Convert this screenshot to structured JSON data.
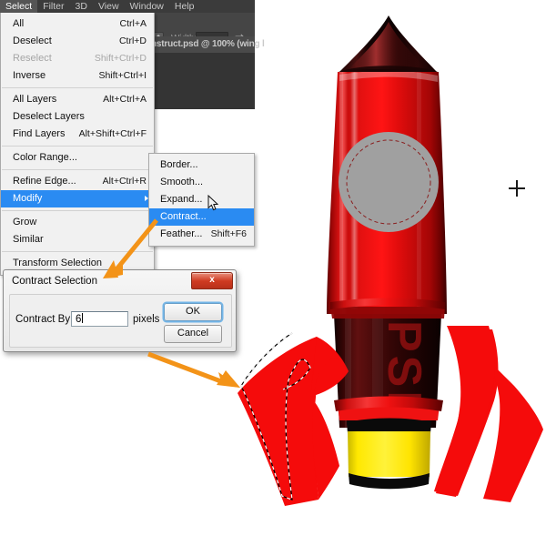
{
  "app": {
    "document_tab": "nstruct.psd @ 100% (wing l",
    "options_bar": {
      "width_label": "Width:",
      "width_value": "",
      "swap_icon": "swap-arrows-icon",
      "stepper_icon": "stepper-icon"
    }
  },
  "menubar": {
    "items": [
      {
        "label": "Select",
        "active": true
      },
      {
        "label": "Filter",
        "active": false
      },
      {
        "label": "3D",
        "active": false
      },
      {
        "label": "View",
        "active": false
      },
      {
        "label": "Window",
        "active": false
      },
      {
        "label": "Help",
        "active": false
      }
    ]
  },
  "select_menu": {
    "groups": [
      [
        {
          "label": "All",
          "accel": "Ctrl+A",
          "disabled": false,
          "highlight": false,
          "submenu": false
        },
        {
          "label": "Deselect",
          "accel": "Ctrl+D",
          "disabled": false,
          "highlight": false,
          "submenu": false
        },
        {
          "label": "Reselect",
          "accel": "Shift+Ctrl+D",
          "disabled": true,
          "highlight": false,
          "submenu": false
        },
        {
          "label": "Inverse",
          "accel": "Shift+Ctrl+I",
          "disabled": false,
          "highlight": false,
          "submenu": false
        }
      ],
      [
        {
          "label": "All Layers",
          "accel": "Alt+Ctrl+A",
          "disabled": false,
          "highlight": false,
          "submenu": false
        },
        {
          "label": "Deselect Layers",
          "accel": "",
          "disabled": false,
          "highlight": false,
          "submenu": false
        },
        {
          "label": "Find Layers",
          "accel": "Alt+Shift+Ctrl+F",
          "disabled": false,
          "highlight": false,
          "submenu": false
        }
      ],
      [
        {
          "label": "Color Range...",
          "accel": "",
          "disabled": false,
          "highlight": false,
          "submenu": false
        }
      ],
      [
        {
          "label": "Refine Edge...",
          "accel": "Alt+Ctrl+R",
          "disabled": false,
          "highlight": false,
          "submenu": false
        },
        {
          "label": "Modify",
          "accel": "",
          "disabled": false,
          "highlight": true,
          "submenu": true
        }
      ],
      [
        {
          "label": "Grow",
          "accel": "",
          "disabled": false,
          "highlight": false,
          "submenu": false
        },
        {
          "label": "Similar",
          "accel": "",
          "disabled": false,
          "highlight": false,
          "submenu": false
        }
      ],
      [
        {
          "label": "Transform Selection",
          "accel": "",
          "disabled": false,
          "highlight": false,
          "submenu": false
        }
      ]
    ]
  },
  "modify_submenu": {
    "items": [
      {
        "label": "Border...",
        "accel": "",
        "highlight": false
      },
      {
        "label": "Smooth...",
        "accel": "",
        "highlight": false
      },
      {
        "label": "Expand...",
        "accel": "",
        "highlight": false
      },
      {
        "label": "Contract...",
        "accel": "",
        "highlight": true
      },
      {
        "label": "Feather...",
        "accel": "Shift+F6",
        "highlight": false
      }
    ]
  },
  "dialog": {
    "title": "Contract Selection",
    "close_label": "x",
    "field_label": "Contract By:",
    "field_value": "6",
    "units": "pixels",
    "ok_label": "OK",
    "cancel_label": "Cancel"
  },
  "canvas": {
    "artwork_name": "rocket-illustration",
    "decal_text": "PSD",
    "annotation_color": "#f39318",
    "arrows": [
      {
        "name": "arrow-to-dialog"
      },
      {
        "name": "arrow-to-fin-selection"
      }
    ],
    "cursors": [
      {
        "name": "pointer-cursor"
      },
      {
        "name": "crosshair-cursor"
      }
    ]
  },
  "colors": {
    "menu_highlight": "#2a8bf2",
    "chrome": "#3b3b3b",
    "menu_bg": "#f1f1f1",
    "rocket_red": "#e60d0d",
    "rocket_dark": "#1c0708",
    "engine_yellow": "#ffee00",
    "window_gray": "#a0a0a0",
    "annotation_orange": "#f39318"
  }
}
